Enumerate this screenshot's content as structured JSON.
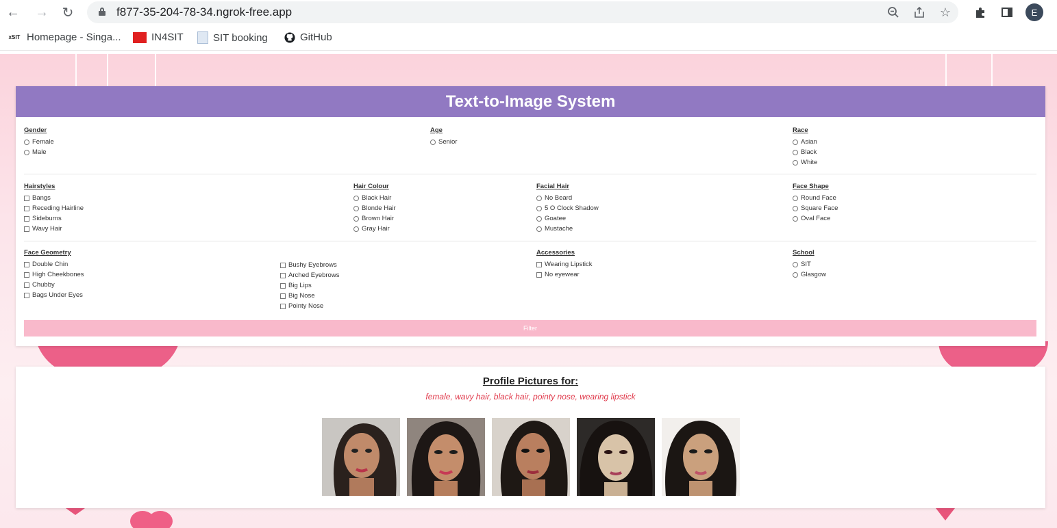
{
  "browser": {
    "url": "f877-35-204-78-34.ngrok-free.app",
    "avatar_letter": "E",
    "bookmarks": [
      {
        "label": "Homepage - Singa...",
        "icon": "sit-logo-icon"
      },
      {
        "label": "IN4SIT",
        "icon": "in4sit-icon"
      },
      {
        "label": "SIT booking",
        "icon": "document-icon"
      },
      {
        "label": "GitHub",
        "icon": "github-icon"
      }
    ]
  },
  "form": {
    "title": "Text-to-Image System",
    "groups": {
      "gender": {
        "title": "Gender",
        "type": "radio",
        "options": [
          "Female",
          "Male"
        ]
      },
      "age": {
        "title": "Age",
        "type": "radio",
        "options": [
          "Senior"
        ]
      },
      "race": {
        "title": "Race",
        "type": "radio",
        "options": [
          "Asian",
          "Black",
          "White"
        ]
      },
      "hairstyles": {
        "title": "Hairstyles",
        "type": "checkbox",
        "options": [
          "Bangs",
          "Receding Hairline",
          "Sideburns",
          "Wavy Hair"
        ]
      },
      "hair_colour": {
        "title": "Hair Colour",
        "type": "radio",
        "options": [
          "Black Hair",
          "Blonde Hair",
          "Brown Hair",
          "Gray Hair"
        ]
      },
      "facial_hair": {
        "title": "Facial Hair",
        "type": "radio",
        "options": [
          "No Beard",
          "5 O Clock Shadow",
          "Goatee",
          "Mustache"
        ]
      },
      "face_shape": {
        "title": "Face Shape",
        "type": "radio",
        "options": [
          "Round Face",
          "Square Face",
          "Oval Face"
        ]
      },
      "face_geometry": {
        "title": "Face Geometry",
        "type": "checkbox",
        "options": [
          "Double Chin",
          "High Cheekbones",
          "Chubby",
          "Bags Under Eyes"
        ],
        "options_col2": [
          "Bushy Eyebrows",
          "Arched Eyebrows",
          "Big Lips",
          "Big Nose",
          "Pointy Nose"
        ]
      },
      "accessories": {
        "title": "Accessories",
        "type": "checkbox",
        "options": [
          "Wearing Lipstick",
          "No eyewear"
        ]
      },
      "school": {
        "title": "School",
        "type": "radio",
        "options": [
          "SIT",
          "Glasgow"
        ]
      }
    },
    "filter_label": "Filter"
  },
  "results": {
    "title": "Profile Pictures for:",
    "query": "female, wavy hair, black hair, pointy nose, wearing lipstick",
    "images": [
      "profile-picture-1",
      "profile-picture-2",
      "profile-picture-3",
      "profile-picture-4",
      "profile-picture-5"
    ]
  },
  "colors": {
    "header": "#9179c2",
    "filter_button": "#f9b9cb",
    "query_text": "#e0384a"
  }
}
